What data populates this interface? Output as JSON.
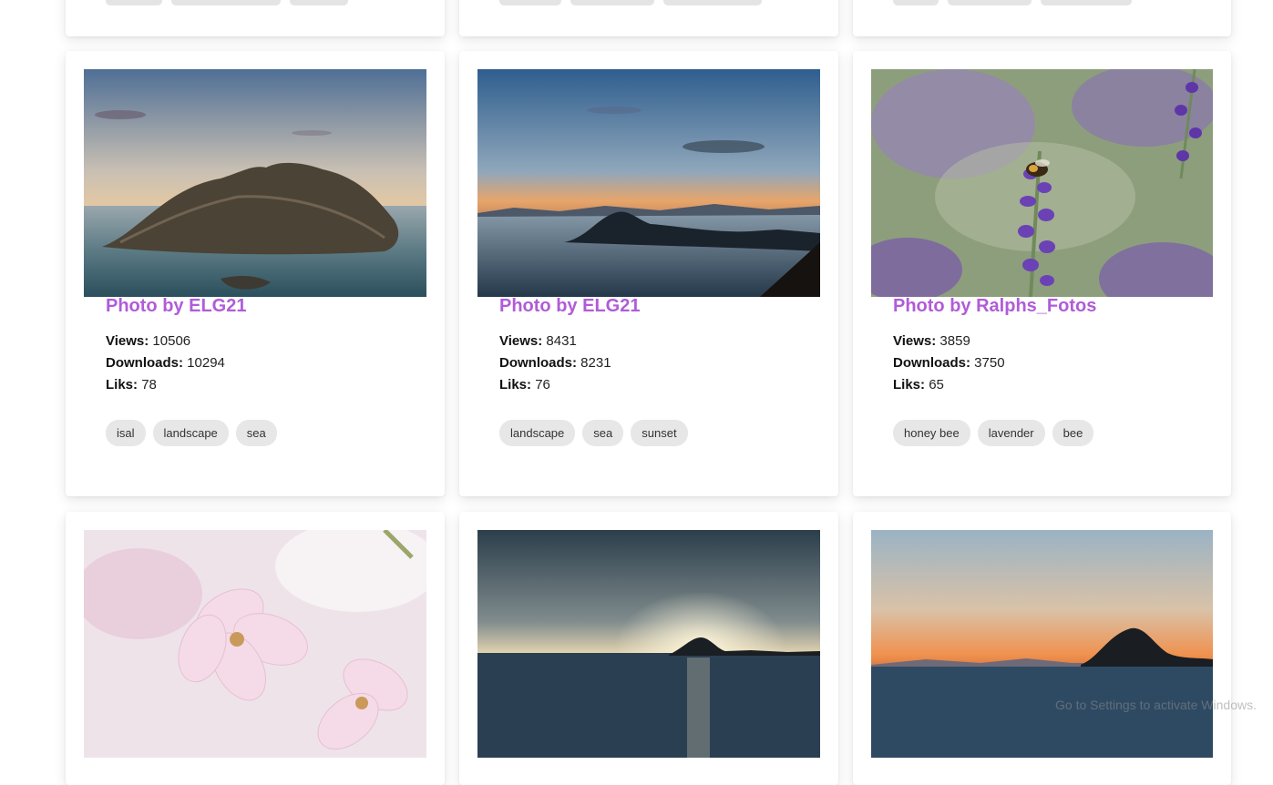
{
  "labels": {
    "views": "Views:",
    "downloads": "Downloads:",
    "likes": "Liks:"
  },
  "cards": [
    {
      "title": "Photo by ELG21",
      "views": "10506",
      "downloads": "10294",
      "likes": "78",
      "tags": [
        "isal",
        "landscape",
        "sea"
      ],
      "image_icon": "rocky-island-sea-photo"
    },
    {
      "title": "Photo by ELG21",
      "views": "8431",
      "downloads": "8231",
      "likes": "76",
      "tags": [
        "landscape",
        "sea",
        "sunset"
      ],
      "image_icon": "coastal-sunset-photo"
    },
    {
      "title": "Photo by Ralphs_Fotos",
      "views": "3859",
      "downloads": "3750",
      "likes": "65",
      "tags": [
        "honey bee",
        "lavender",
        "bee"
      ],
      "image_icon": "lavender-bee-photo"
    }
  ],
  "next_row": [
    {
      "image_icon": "cherry-blossom-photo"
    },
    {
      "image_icon": "sea-sunrise-photo"
    },
    {
      "image_icon": "island-sunset-photo"
    }
  ],
  "watermark": "Go to Settings to activate Windows.",
  "colors": {
    "title": "#b05cd8",
    "tag_bg": "#e7e7e7"
  }
}
